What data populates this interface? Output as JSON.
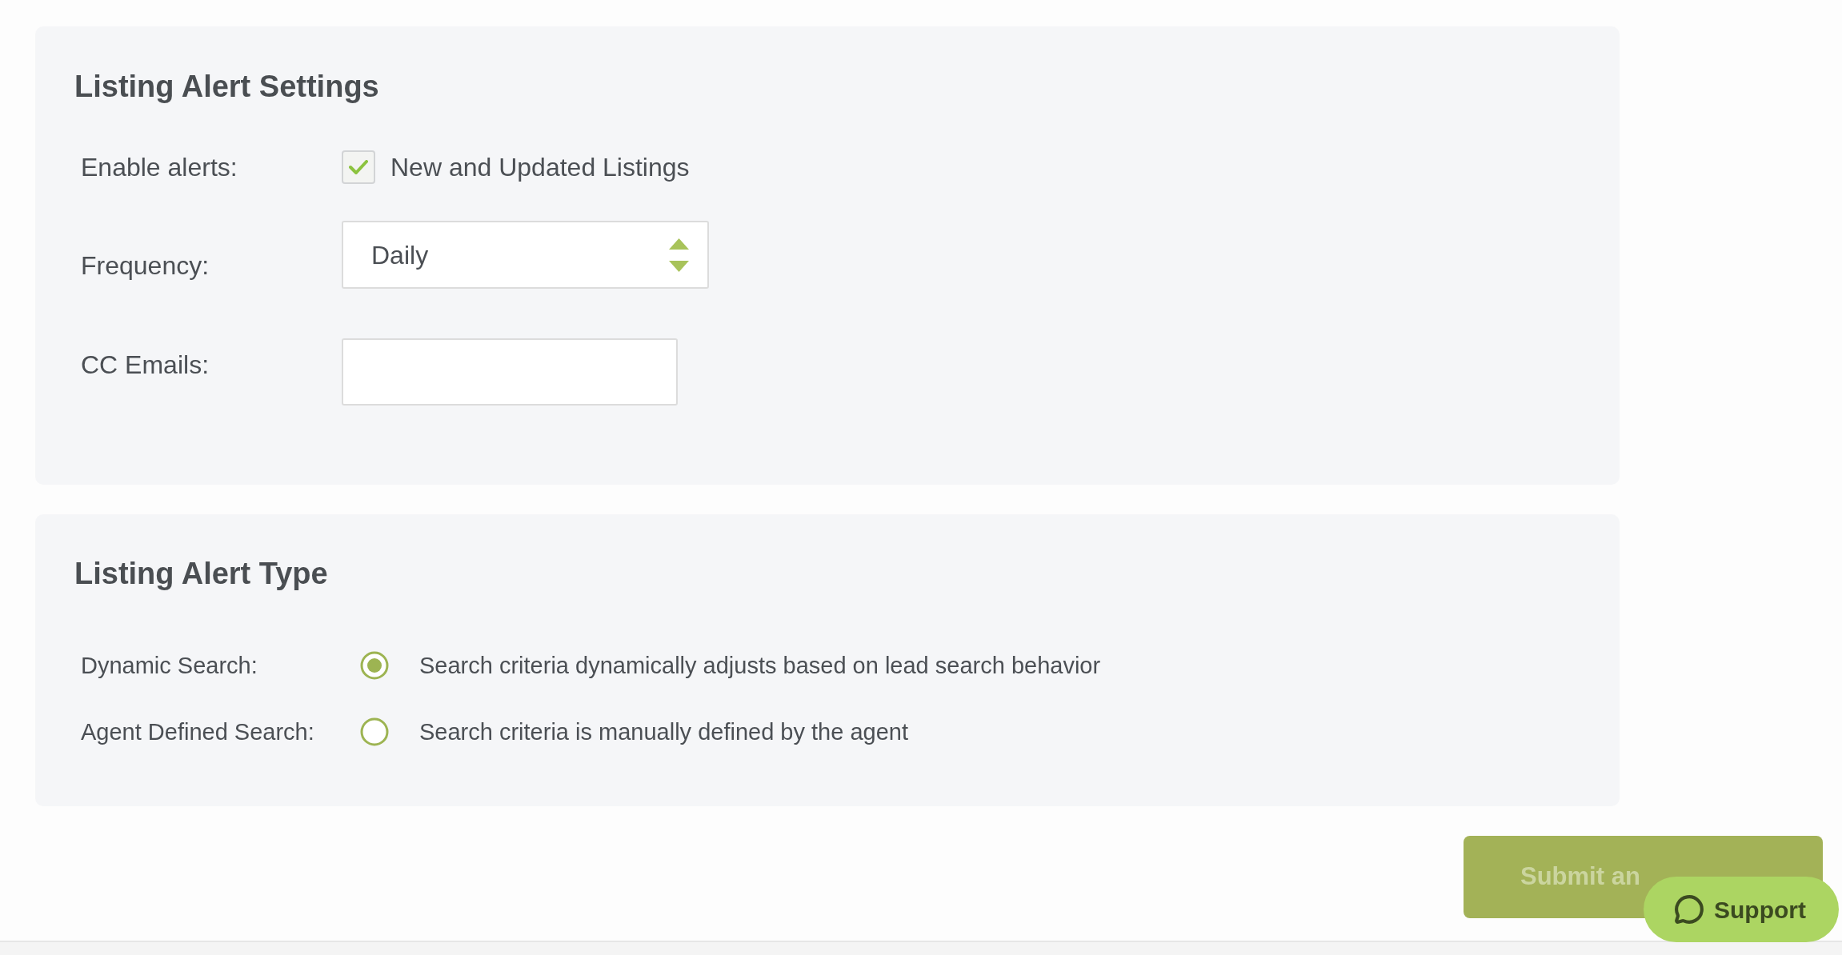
{
  "settings_section": {
    "title": "Listing Alert Settings",
    "enable_alerts": {
      "label": "Enable alerts:",
      "option": "New and Updated Listings",
      "checked": true
    },
    "frequency": {
      "label": "Frequency:",
      "value": "Daily"
    },
    "cc_emails": {
      "label": "CC Emails:"
    }
  },
  "type_section": {
    "title": "Listing Alert Type",
    "options": [
      {
        "label": "Dynamic Search:",
        "description": "Search criteria dynamically adjusts based on lead search behavior",
        "selected": true
      },
      {
        "label": "Agent Defined Search:",
        "description": "Search criteria is manually defined by the agent",
        "selected": false
      }
    ]
  },
  "submit_button": {
    "label": "Submit an",
    "disabled": true
  },
  "support_button": {
    "label": "Support"
  }
}
